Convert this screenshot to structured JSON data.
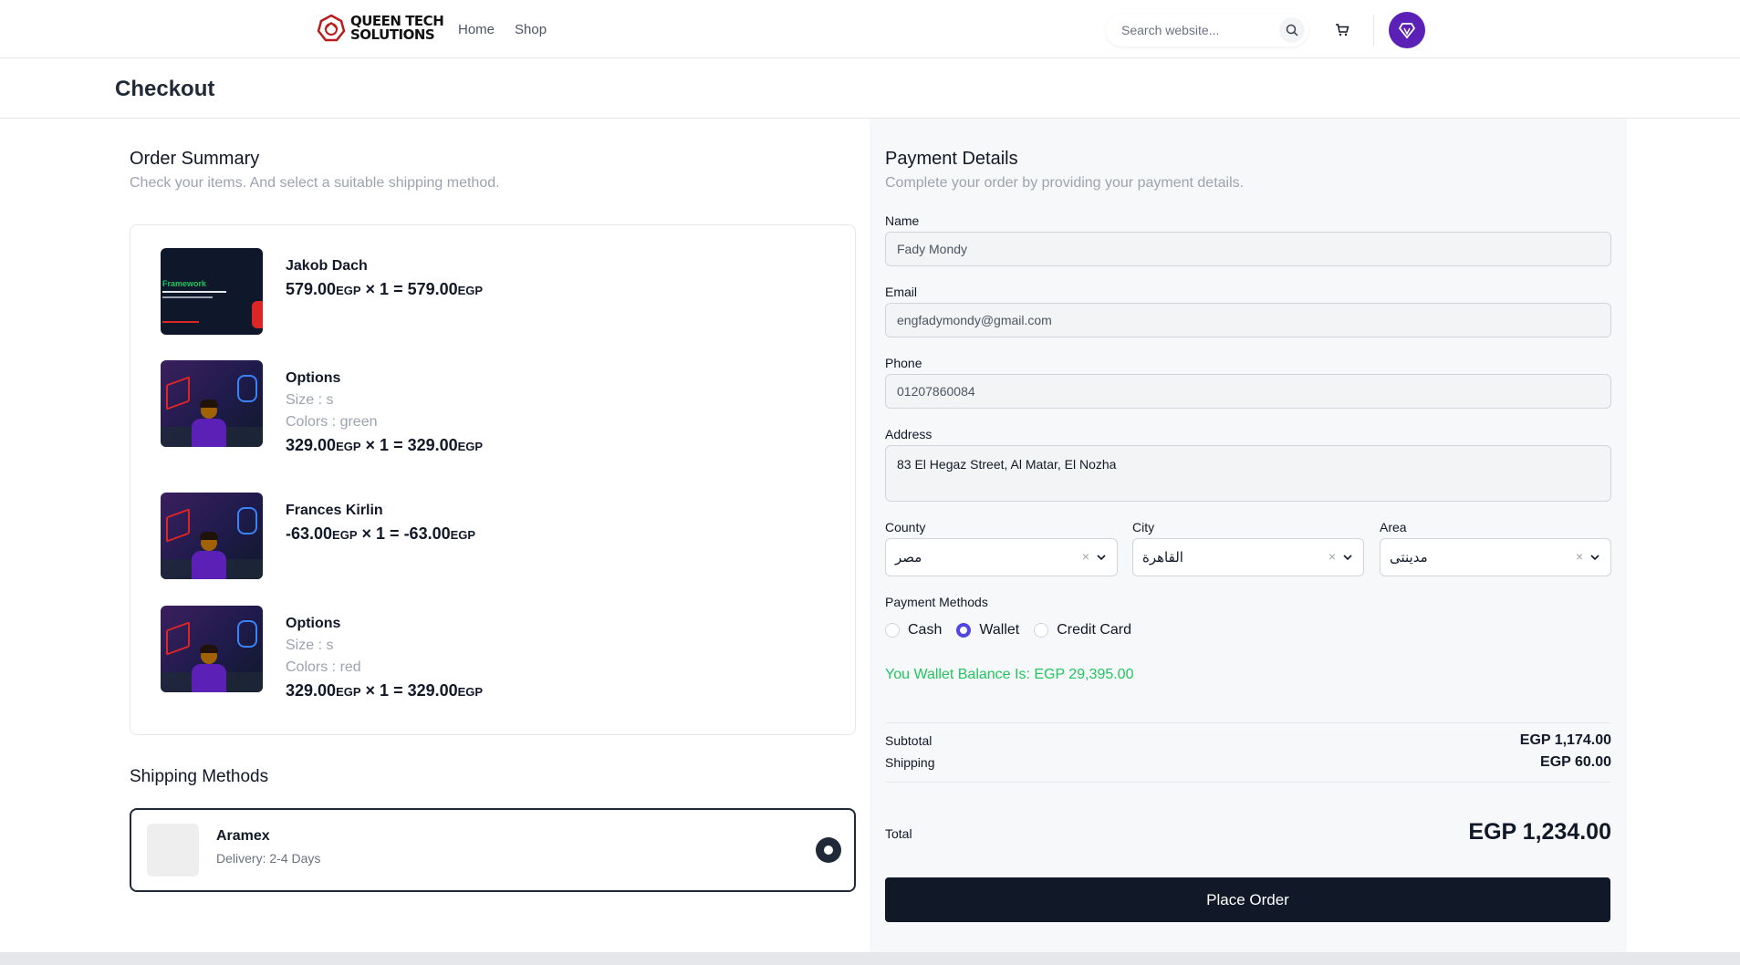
{
  "brand": {
    "line1": "QUEEN TECH",
    "line2": "SOLUTIONS"
  },
  "nav": {
    "home": "Home",
    "shop": "Shop"
  },
  "search": {
    "placeholder": "Search website..."
  },
  "page": {
    "title": "Checkout"
  },
  "order_summary": {
    "title": "Order Summary",
    "subtitle": "Check your items. And select a suitable shipping method.",
    "items": [
      {
        "name": "Jakob Dach",
        "thumb_text": "Framework",
        "options": [],
        "price": "579.00",
        "currency": "EGP",
        "qty": "1",
        "total": "579.00"
      },
      {
        "name": "Options",
        "options": [
          "Size : s",
          "Colors : green"
        ],
        "price": "329.00",
        "currency": "EGP",
        "qty": "1",
        "total": "329.00"
      },
      {
        "name": "Frances Kirlin",
        "options": [],
        "price": "-63.00",
        "currency": "EGP",
        "qty": "1",
        "total": "-63.00"
      },
      {
        "name": "Options",
        "options": [
          "Size : s",
          "Colors : red"
        ],
        "price": "329.00",
        "currency": "EGP",
        "qty": "1",
        "total": "329.00"
      }
    ]
  },
  "shipping": {
    "title": "Shipping Methods",
    "method": {
      "name": "Aramex",
      "delivery": "Delivery: 2-4 Days",
      "selected": true
    }
  },
  "payment": {
    "title": "Payment Details",
    "subtitle": "Complete your order by providing your payment details.",
    "name_label": "Name",
    "name_value": "Fady Mondy",
    "email_label": "Email",
    "email_value": "engfadymondy@gmail.com",
    "phone_label": "Phone",
    "phone_value": "01207860084",
    "address_label": "Address",
    "address_value": "83 El Hegaz Street, Al Matar, El Nozha",
    "county_label": "County",
    "county_value": "مصر",
    "city_label": "City",
    "city_value": "القاهرة",
    "area_label": "Area",
    "area_value": "مدينتى",
    "methods_label": "Payment Methods",
    "methods": [
      "Cash",
      "Wallet",
      "Credit Card"
    ],
    "selected_method": "Wallet",
    "wallet_balance": "You Wallet Balance Is: EGP 29,395.00"
  },
  "totals": {
    "subtotal_label": "Subtotal",
    "subtotal_value": "EGP 1,174.00",
    "shipping_label": "Shipping",
    "shipping_value": "EGP 60.00",
    "total_label": "Total",
    "total_value": "EGP 1,234.00"
  },
  "actions": {
    "place_order": "Place Order"
  },
  "colors": {
    "accent": "#4f46e5",
    "avatar": "#5b21b6",
    "success": "#22c55e",
    "button": "#111827"
  }
}
